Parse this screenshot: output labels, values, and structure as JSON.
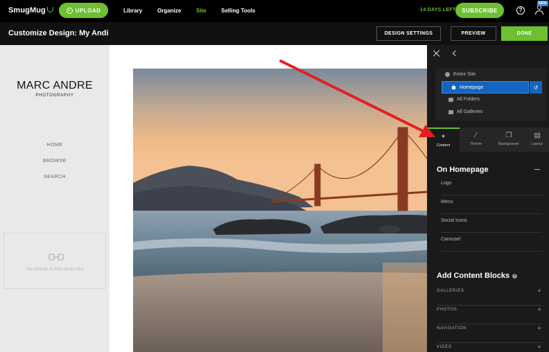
{
  "topnav": {
    "logo": "SmugMug",
    "upload_label": "UPLOAD",
    "links": [
      "Library",
      "Organize",
      "Site",
      "Selling Tools"
    ],
    "trial": "14 DAYS LEFT",
    "subscribe_label": "SUBSCRIBE",
    "help_glyph": "?",
    "new_badge": "NEW"
  },
  "titlebar": {
    "title": "Customize Design: My Andi",
    "design_settings": "DESIGN SETTINGS",
    "preview": "PREVIEW",
    "done": "DONE"
  },
  "site": {
    "brand_name": "MARC ANDRE",
    "brand_sub": "PHOTOGRAPHY",
    "menu": [
      "HOME",
      "BROWSE",
      "SEARCH"
    ],
    "social_empty": "NO SOCIAL ICONS SELECTED"
  },
  "panel": {
    "scopes": {
      "entire_site": "Entire Site",
      "homepage": "Homepage",
      "all_folders": "All Folders",
      "all_galleries": "All Galleries"
    },
    "tabs": [
      "Content",
      "Theme",
      "Background",
      "Layout"
    ],
    "section_title": "On Homepage",
    "options": [
      "Logo",
      "Menu",
      "Social Icons",
      "Carousel"
    ],
    "add_blocks_title": "Add Content Blocks",
    "info_glyph": "?",
    "blocks": [
      "GALLERIES",
      "PHOTOS",
      "NAVIGATION",
      "VIDEO"
    ]
  },
  "colors": {
    "accent": "#6dc031",
    "selected": "#1565c0",
    "arrow": "#e41e1e"
  }
}
